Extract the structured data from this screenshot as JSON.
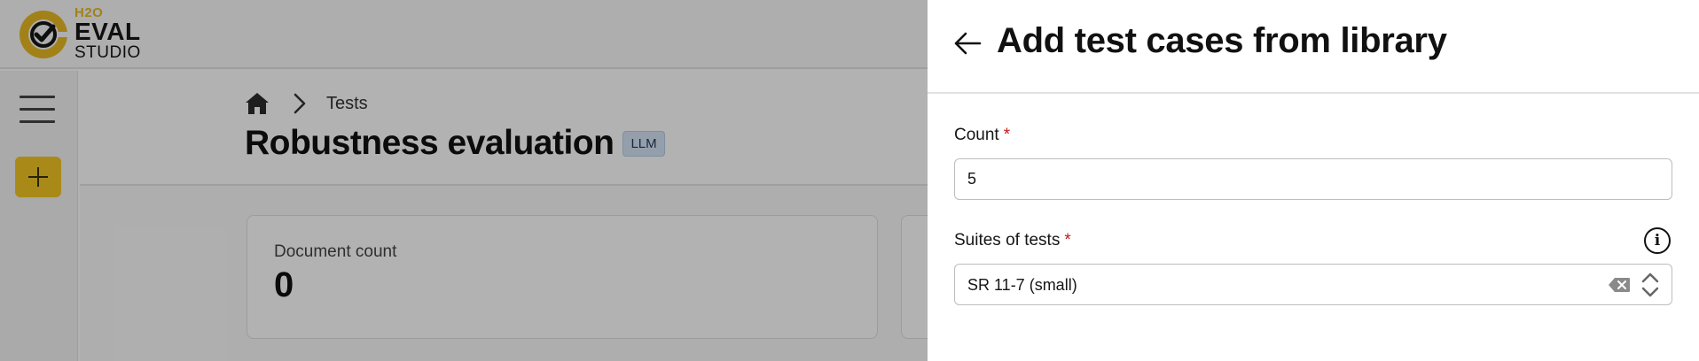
{
  "app": {
    "logo": {
      "line1": "H2O",
      "line2": "EVAL",
      "line3": "STUDIO"
    },
    "breadcrumb": {
      "home_icon": "home-icon",
      "separator_icon": "chevron-right-icon",
      "current": "Tests"
    },
    "page": {
      "title": "Robustness evaluation",
      "badge": "LLM"
    },
    "cards": [
      {
        "label": "Document count",
        "value": "0"
      }
    ],
    "sidebar": {
      "menu_icon": "hamburger-menu-icon",
      "add_icon": "plus-icon"
    },
    "colors": {
      "accent": "#f3c623",
      "logo_gold": "#e8b923",
      "required": "#c21a1a"
    }
  },
  "drawer": {
    "title": "Add test cases from library",
    "back_icon": "arrow-left-icon",
    "count": {
      "label": "Count",
      "required_mark": "*",
      "value": "5"
    },
    "suites": {
      "label": "Suites of tests",
      "required_mark": "*",
      "selected": "SR 11-7 (small)",
      "info_icon": "info-icon",
      "info_glyph": "i",
      "clear_icon": "clear-icon",
      "toggle_icon": "chevron-updown-icon"
    }
  }
}
